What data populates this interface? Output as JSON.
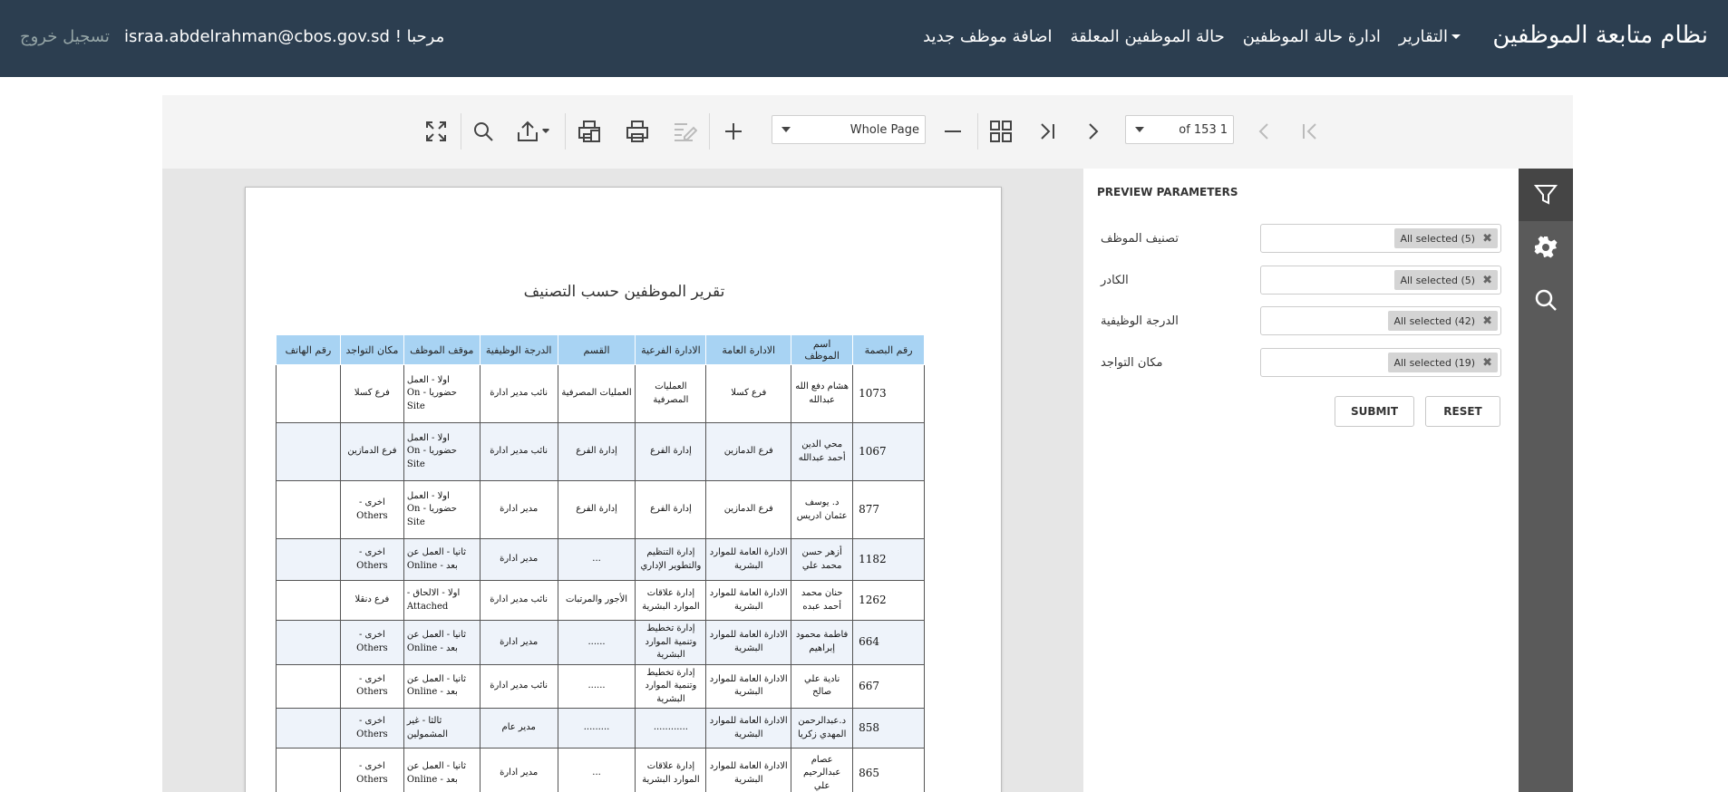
{
  "navbar": {
    "brand": "نظام متابعة الموظفين",
    "links": [
      "اضافة موظف جديد",
      "حالة الموظفين المعلقة",
      "ادارة حالة الموظفين"
    ],
    "reports_label": "التقارير",
    "greeting": "مرحبا ! israa.abdelrahman@cbos.gov.sd",
    "logout": "تسجيل خروج"
  },
  "toolbar": {
    "page_number": "1",
    "page_total": "of 153",
    "zoom_value": "Whole Page",
    "icons": [
      "fullscreen-icon",
      "search-icon",
      "export-icon",
      "print-page-icon",
      "print-icon",
      "edit-icon",
      "zoom-in-icon",
      "zoom-out-icon",
      "multipage-icon",
      "last-page-icon",
      "next-page-icon",
      "prev-page-icon",
      "first-page-icon"
    ]
  },
  "report": {
    "title": "تقرير الموظفين حسب التصنيف",
    "columns": [
      "رقم البصمة",
      "اسم الموظف",
      "الادارة العامة",
      "الادارة الفرعية",
      "القسم",
      "الدرجة الوظيفية",
      "موقف الموظف",
      "مكان التواجد",
      "رقم الهاتف"
    ],
    "rows": [
      {
        "id": "1073",
        "name": "هشام دفع الله عبدالله",
        "dept": "فرع كسلا",
        "sub": "العمليات المصرفية",
        "section": "العمليات المصرفية",
        "grade": "نائب مدير ادارة",
        "status": "اولا - العمل حضوريا - On Site",
        "location": "فرع كسلا",
        "phone": ""
      },
      {
        "id": "1067",
        "name": "محي الدين أحمد عبدالله",
        "dept": "فرع الدمازين",
        "sub": "إدارة الفرع",
        "section": "إدارة الفرع",
        "grade": "نائب مدير ادارة",
        "status": "اولا - العمل حضوريا - On Site",
        "location": "فرع الدمازين",
        "phone": ""
      },
      {
        "id": "877",
        "name": "د. يوسف عثمان ادريس",
        "dept": "فرع الدمازين",
        "sub": "إدارة الفرع",
        "section": "إدارة الفرع",
        "grade": "مدير ادارة",
        "status": "اولا - العمل حضوريا - On Site",
        "location": "اخرى - Others",
        "phone": ""
      },
      {
        "id": "1182",
        "name": "أزهر حسن محمد علي",
        "dept": "الادارة العامة للموارد البشرية",
        "sub": "إدارة التنظيم والتطوير الإداري",
        "section": "...",
        "grade": "مدير ادارة",
        "status": "ثانيا - العمل عن بعد - Online",
        "location": "اخرى - Others",
        "phone": ""
      },
      {
        "id": "1262",
        "name": "حنان محمد أحمد عبده",
        "dept": "الادارة العامة للموارد البشرية",
        "sub": "إدارة علاقات الموارد البشرية",
        "section": "الأجور والمرتبات",
        "grade": "نائب مدير ادارة",
        "status": "اولا - الالحاق - Attached",
        "location": "فرع دنقلا",
        "phone": ""
      },
      {
        "id": "664",
        "name": "فاطمة محمود إبراهيم",
        "dept": "الادارة العامة للموارد البشرية",
        "sub": "إدارة تخطيط وتنمية الموارد البشرية",
        "section": "......",
        "grade": "مدير ادارة",
        "status": "ثانيا - العمل عن بعد - Online",
        "location": "اخرى - Others",
        "phone": ""
      },
      {
        "id": "667",
        "name": "نادية علي صالح",
        "dept": "الادارة العامة للموارد البشرية",
        "sub": "إدارة تخطيط وتنمية الموارد البشرية",
        "section": "......",
        "grade": "نائب مدير ادارة",
        "status": "ثانيا - العمل عن بعد - Online",
        "location": "اخرى - Others",
        "phone": ""
      },
      {
        "id": "858",
        "name": "د.عبدالرحمن المهدي زكريا",
        "dept": "الادارة العامة للموارد البشرية",
        "sub": "............",
        "section": ".........",
        "grade": "مدير عام",
        "status": "ثالثا - غير المشمولين",
        "location": "اخرى - Others",
        "phone": ""
      },
      {
        "id": "865",
        "name": "عصام عبدالرحيم علي",
        "dept": "الادارة العامة للموارد البشرية",
        "sub": "إدارة علاقات الموارد البشرية",
        "section": "...",
        "grade": "مدير ادارة",
        "status": "ثانيا - العمل عن بعد - Online",
        "location": "اخرى - Others",
        "phone": ""
      }
    ]
  },
  "params": {
    "title": "PREVIEW PARAMETERS",
    "items": [
      {
        "label": "تصنيف الموظف",
        "value": "All selected (5)"
      },
      {
        "label": "الكادر",
        "value": "All selected (5)"
      },
      {
        "label": "الدرجة الوظيفية",
        "value": "All selected (42)"
      },
      {
        "label": "مكان التواجد",
        "value": "All selected (19)"
      }
    ],
    "submit": "SUBMIT",
    "reset": "RESET",
    "chip_clear": "✖"
  },
  "side_tabs": [
    "filter-icon",
    "gear-icon",
    "search-icon"
  ]
}
